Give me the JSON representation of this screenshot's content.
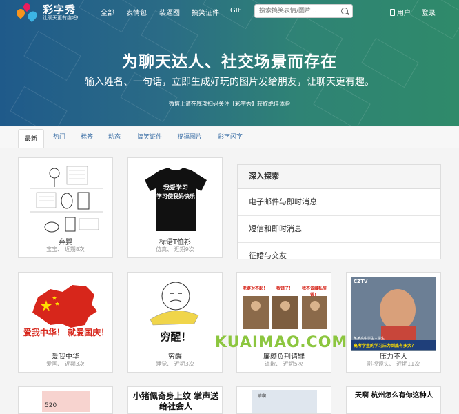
{
  "nav": {
    "brand": "彩字秀",
    "slogan": "让聊天更有趣吧!",
    "links": [
      "全部",
      "表情包",
      "装逼图",
      "搞笑证件",
      "GIF"
    ],
    "search_placeholder": "搜索搞笑表情/图片...",
    "user": "用户",
    "login": "登录"
  },
  "hero": {
    "title": "为聊天达人、社交场景而存在",
    "subtitle": "输入姓名、一句话，立即生成好玩的图片发给朋友，让聊天更有趣。",
    "note": "微信上请在底部扫码关注【彩字秀】获取绝佳体验"
  },
  "tabs": [
    "最新",
    "热门",
    "标签",
    "动态",
    "搞笑证件",
    "祝福图片",
    "彩字闪字"
  ],
  "explore": {
    "heading": "深入探索",
    "items": [
      "电子邮件与即时消息",
      "短信和即时消息",
      "征婚与交友"
    ]
  },
  "cards_row1": [
    {
      "title": "弃婴",
      "meta": "宝宝、 近期8次"
    },
    {
      "title": "标语T恤衫",
      "meta": "仿真、 近期9次",
      "shirt_line1": "我爱学习",
      "shirt_line2": "学习使我妈快乐"
    }
  ],
  "cards_row2": [
    {
      "title": "爱我中华",
      "meta": "爱国、 近期3次",
      "img_text": "爱我中华！ 就爱国庆！"
    },
    {
      "title": "穷醒",
      "meta": "睡觉、 近期3次",
      "img_text": "穷醒！"
    },
    {
      "title": "廉颇负荆请罪",
      "meta": "道歉、 近期5次",
      "img_labels": [
        "老婆对不起！",
        "我错了！",
        "我不该藏私房钱！"
      ]
    },
    {
      "title": "压力不大",
      "meta": "影视镜头、 近期11次",
      "img_caption": "高考学生的学习压力到底有多大？",
      "img_top": "CZTV",
      "img_small": "某某高中学生三学生"
    }
  ],
  "cards_row3": [
    {
      "img_text": "520"
    },
    {
      "img_text": "小猪佩奇身上纹 掌声送给社会人"
    },
    {
      "img_text": "谁啊"
    },
    {
      "img_text": "天啊 杭州怎么有你这种人"
    }
  ],
  "watermark": "KUAIMAO.COM",
  "colors": {
    "accent": "#3a6ea5",
    "watermark": "#8cc63f",
    "flag_red": "#d7261b"
  }
}
